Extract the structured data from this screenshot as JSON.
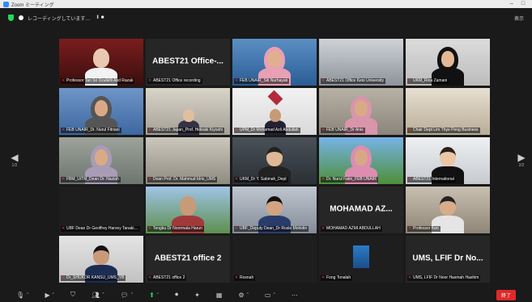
{
  "window": {
    "title": "Zoom ミーティング",
    "minimize": "–",
    "maximize": "□"
  },
  "topbar": {
    "recording_label": "レコーディングしています…",
    "pause": "II",
    "stop": "■",
    "view_label": "表示"
  },
  "tiles": [
    {
      "label": "Professor Tan Sri Dzulkifli Abd Razak",
      "display_name": "",
      "scene": "elder"
    },
    {
      "label": "ABEST21 Office recording",
      "display_name": "ABEST21 Office-...",
      "scene": "name"
    },
    {
      "label": "FEB UNAIR_Siti Nurhayati",
      "display_name": "",
      "scene": "hijab-blue"
    },
    {
      "label": "ABEST21 Office Keio University",
      "display_name": "",
      "scene": "room"
    },
    {
      "label": "UKM_Rina Zamani",
      "display_name": "",
      "scene": "hijab-black"
    },
    {
      "label": "FEB UNAIR_Dr. Nurul Fitriani",
      "display_name": "",
      "scene": "hijab-blue2"
    },
    {
      "label": "ABEST21 Japan_Prof. Hideaki Kiyoshi",
      "display_name": "",
      "scene": "office"
    },
    {
      "label": "UPM_Dr Mohamad Azli Abdullah",
      "display_name": "",
      "scene": "logo-man"
    },
    {
      "label": "FEB UNAIR_Dr Anis",
      "display_name": "",
      "scene": "hijab-pink"
    },
    {
      "label": "Chair Dept Lim Thye Peng Business",
      "display_name": "",
      "scene": "classroom"
    },
    {
      "label": "FBM_UiTM_Dean Dr. Naziah",
      "display_name": "",
      "scene": "hijab-gray"
    },
    {
      "label": "Dean Prof. Dr. Mahmud Idris_UMS",
      "display_name": "",
      "scene": "meeting"
    },
    {
      "label": "UKM_Dr Y. Sabinah_Dept",
      "display_name": "",
      "scene": "woman-dark"
    },
    {
      "label": "Dr. Nurul Fatin_FEB UNAIR",
      "display_name": "",
      "scene": "hijab-field"
    },
    {
      "label": "ABEST21 International",
      "display_name": "",
      "scene": "asian-woman"
    },
    {
      "label": "UBF Dean Dr Geoffrey Harvey Tanakinjal",
      "display_name": "",
      "scene": "dark"
    },
    {
      "label": "Tengku Dr Noormala Harun",
      "display_name": "",
      "scene": "man-outdoor"
    },
    {
      "label": "UBF_Deputy Dean_Dr Rosle Mohidin",
      "display_name": "",
      "scene": "man-glasses"
    },
    {
      "label": "MOHAMAD AZMI ABDULLAH",
      "display_name": "MOHAMAD AZ...",
      "scene": "name"
    },
    {
      "label": "Professor Ken",
      "display_name": "",
      "scene": "man-shelf"
    },
    {
      "label": "Dr_SHUKOR KANSU_UMS_YB",
      "display_name": "",
      "scene": "man-blue"
    },
    {
      "label": "ABEST21 office 2",
      "display_name": "ABEST21 office 2",
      "scene": "name"
    },
    {
      "label": "Rosnah",
      "display_name": "",
      "scene": "dark"
    },
    {
      "label": "Fong Tonalah",
      "display_name": "",
      "scene": "book"
    },
    {
      "label": "UMS, LFIF Dr Noor Hasmah Hashim",
      "display_name": "UMS, LFIF Dr No...",
      "scene": "name"
    }
  ],
  "active_tile_index": 14,
  "nav": {
    "left_arrow": "◀",
    "left_page": "1/2",
    "right_arrow": "▶",
    "right_page": "2/2"
  },
  "toolbar": {
    "mic_icon": "mic-icon",
    "video_icon": "video-icon",
    "end_label": "終了"
  },
  "colors": {
    "accent": "#2d8cff",
    "active_speaker": "#f5e54a",
    "end_button": "#e02828",
    "secure_green": "#23d959"
  }
}
